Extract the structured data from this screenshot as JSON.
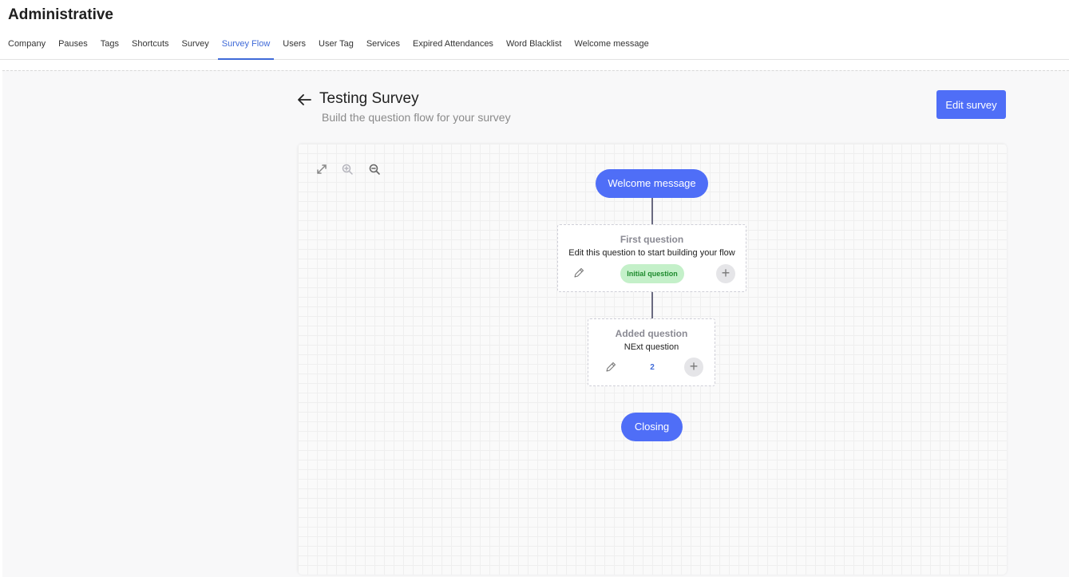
{
  "app": {
    "title": "Administrative"
  },
  "tabs": [
    {
      "label": "Company"
    },
    {
      "label": "Pauses"
    },
    {
      "label": "Tags"
    },
    {
      "label": "Shortcuts"
    },
    {
      "label": "Survey"
    },
    {
      "label": "Survey Flow",
      "active": true
    },
    {
      "label": "Users"
    },
    {
      "label": "User Tag"
    },
    {
      "label": "Services"
    },
    {
      "label": "Expired Attendances"
    },
    {
      "label": "Word Blacklist"
    },
    {
      "label": "Welcome message"
    }
  ],
  "page": {
    "title": "Testing Survey",
    "subtitle": "Build the question flow for your survey",
    "edit_button": "Edit survey"
  },
  "toolbar": {
    "icons": [
      "expand-icon",
      "zoom-in-icon",
      "zoom-out-icon"
    ]
  },
  "flow": {
    "start": "Welcome message",
    "questions": [
      {
        "title": "First question",
        "text": "Edit this question to start building your flow",
        "badge": "Initial question"
      },
      {
        "title": "Added question",
        "text": "NExt question",
        "badge": "2"
      }
    ],
    "end": "Closing",
    "add_symbol": "+"
  },
  "colors": {
    "accent": "#4f6ef7",
    "tab_active": "#3f6ad8",
    "badge_green_bg": "#c4f0c9",
    "badge_green_text": "#1e8a2d"
  }
}
